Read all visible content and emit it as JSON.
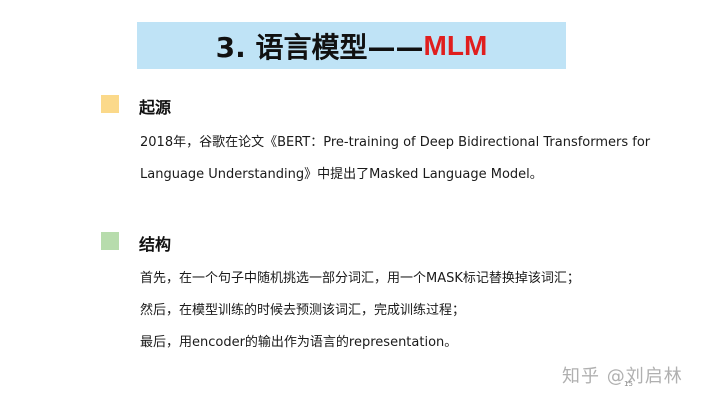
{
  "slide": {
    "title_main": "3. 语言模型——",
    "title_accent": "MLM",
    "title_bg_color": "#bfe3f6",
    "title_accent_color": "#e01e1e",
    "page_number": "15"
  },
  "sections": [
    {
      "heading": "起源",
      "marker_color": "#fbd98a",
      "lines": [
        "2018年，谷歌在论文《BERT：Pre-training of Deep Bidirectional Transformers for",
        "Language Understanding》中提出了Masked Language Model。"
      ]
    },
    {
      "heading": "结构",
      "marker_color": "#b7dcac",
      "lines": [
        "首先，在一个句子中随机挑选一部分词汇，用一个MASK标记替换掉该词汇；",
        "然后，在模型训练的时候去预测该词汇，完成训练过程；",
        "最后，用encoder的输出作为语言的representation。"
      ]
    }
  ],
  "watermark": "知乎 @刘启林"
}
